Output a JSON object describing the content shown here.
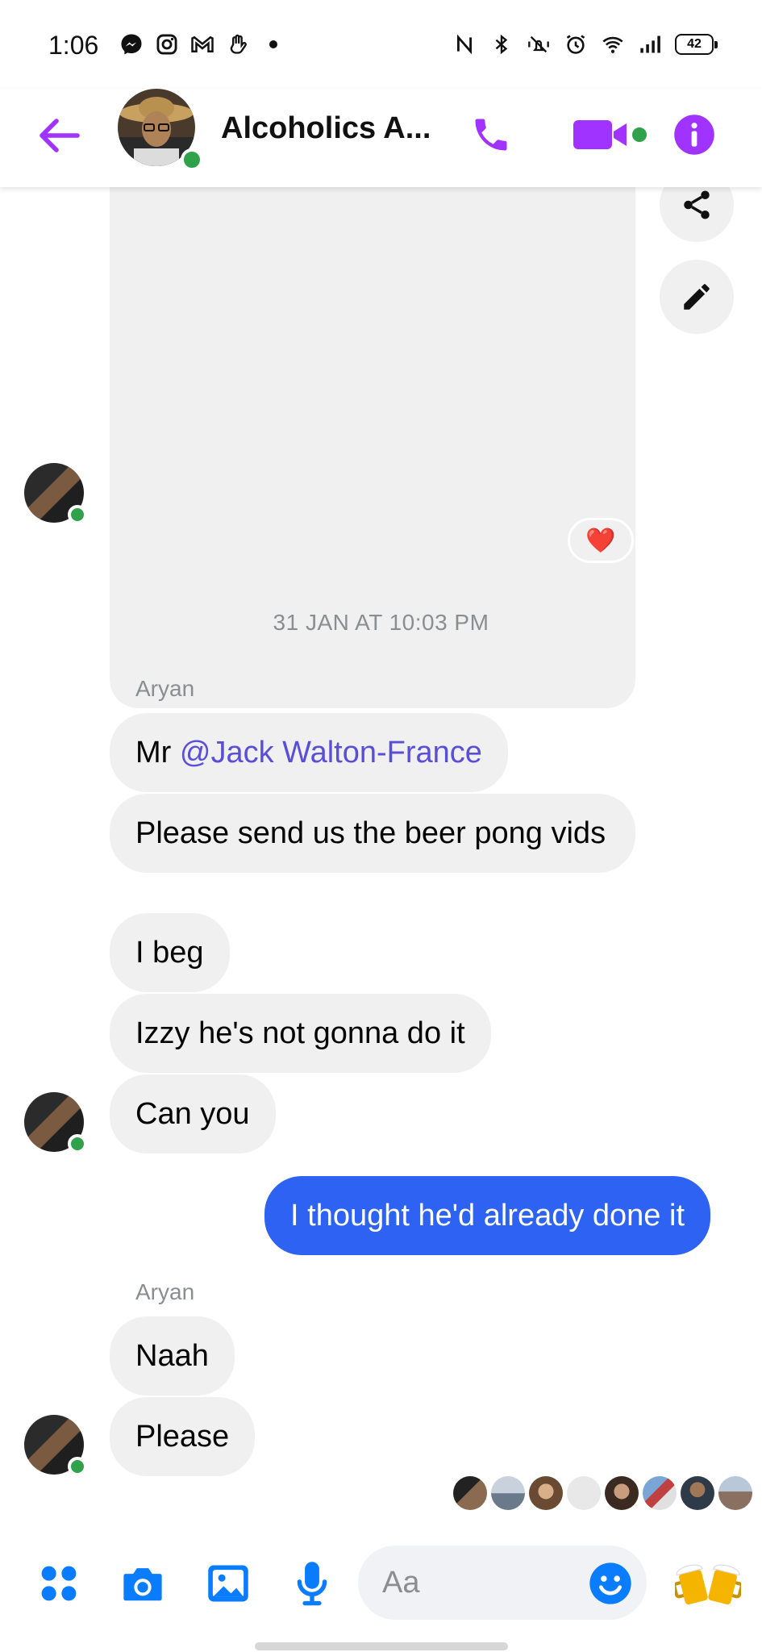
{
  "status_bar": {
    "time": "1:06",
    "battery": "42"
  },
  "header": {
    "title": "Alcoholics A...",
    "accent_color": "#a033ff"
  },
  "chat": {
    "timestamp": "31 JAN AT 10:03 PM",
    "reaction": "❤️",
    "group1": {
      "sender": "Aryan",
      "messages": [
        {
          "prefix": "Mr ",
          "mention": "@Jack Walton-France"
        },
        {
          "text": "Please send us the beer pong vids"
        },
        {
          "text": "I beg"
        },
        {
          "text": "Izzy he's not gonna do it"
        },
        {
          "text": "Can you"
        }
      ]
    },
    "my_message": "I thought he'd already done it",
    "group2": {
      "sender": "Aryan",
      "messages": [
        {
          "text": "Naah"
        },
        {
          "text": "Please"
        }
      ]
    }
  },
  "composer": {
    "placeholder": "Aa",
    "accent_color": "#0a7cff"
  }
}
